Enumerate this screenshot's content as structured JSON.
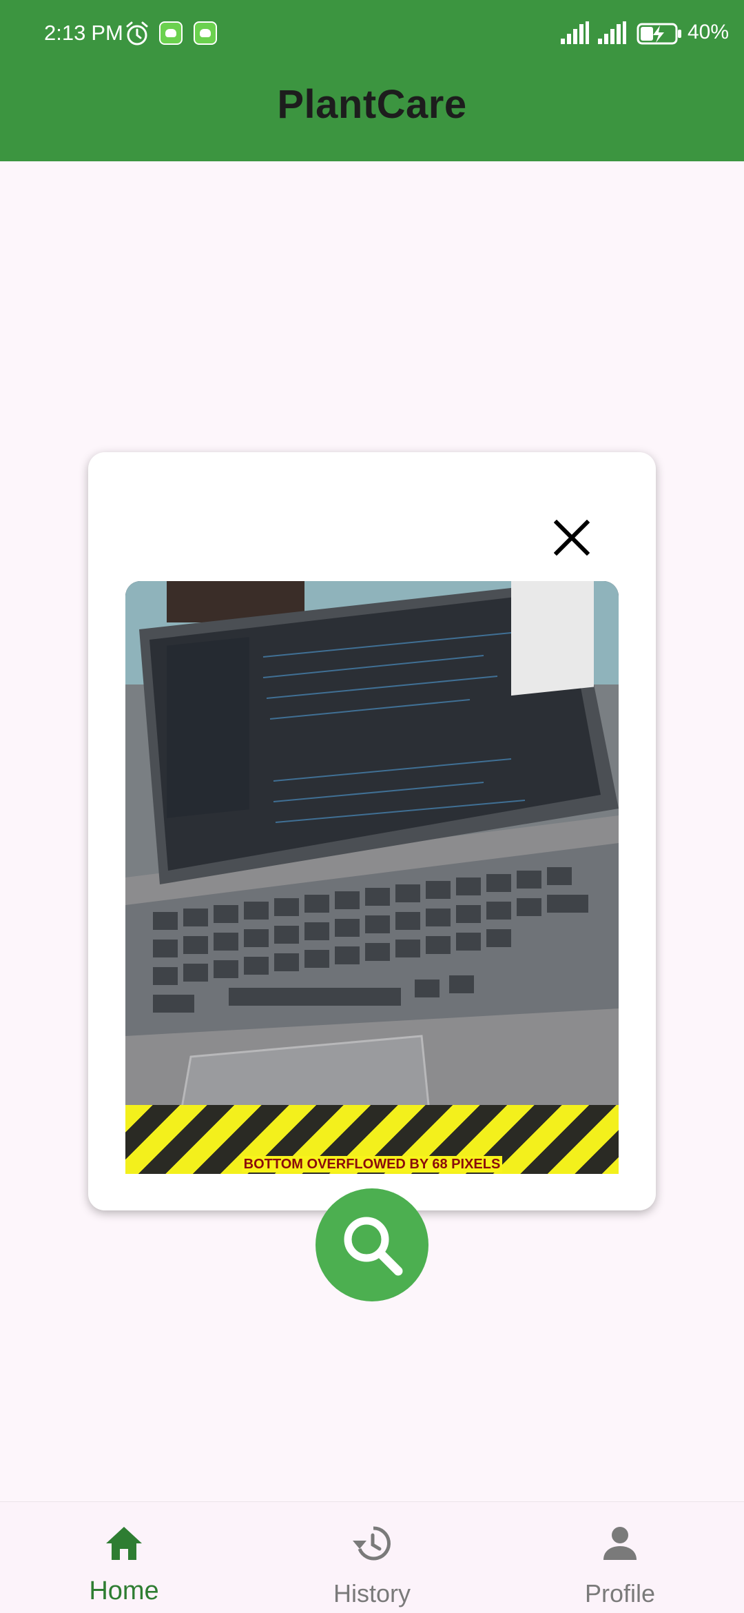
{
  "status_bar": {
    "time": "2:13",
    "ampm": "PM",
    "icons": [
      "alarm-icon",
      "app-notification-icon",
      "app-notification-icon",
      "signal-icon",
      "signal-icon",
      "battery-charging-icon"
    ],
    "battery": "40%"
  },
  "header": {
    "title": "PlantCare",
    "background": "#3c9540"
  },
  "dialog": {
    "close_icon": "close-icon",
    "image_description_icon": "photo",
    "overflow_warning": "BOTTOM OVERFLOWED BY 68 PIXELS"
  },
  "actions": {
    "search_icon": "search-icon",
    "accent": "#4caf50"
  },
  "bottom_nav": {
    "items": [
      {
        "label": "Home",
        "icon": "home-icon",
        "active": true
      },
      {
        "label": "History",
        "icon": "history-icon",
        "active": false
      },
      {
        "label": "Profile",
        "icon": "person-icon",
        "active": false
      }
    ],
    "active_color": "#2e7d32",
    "inactive_color": "#7a7a7a"
  }
}
